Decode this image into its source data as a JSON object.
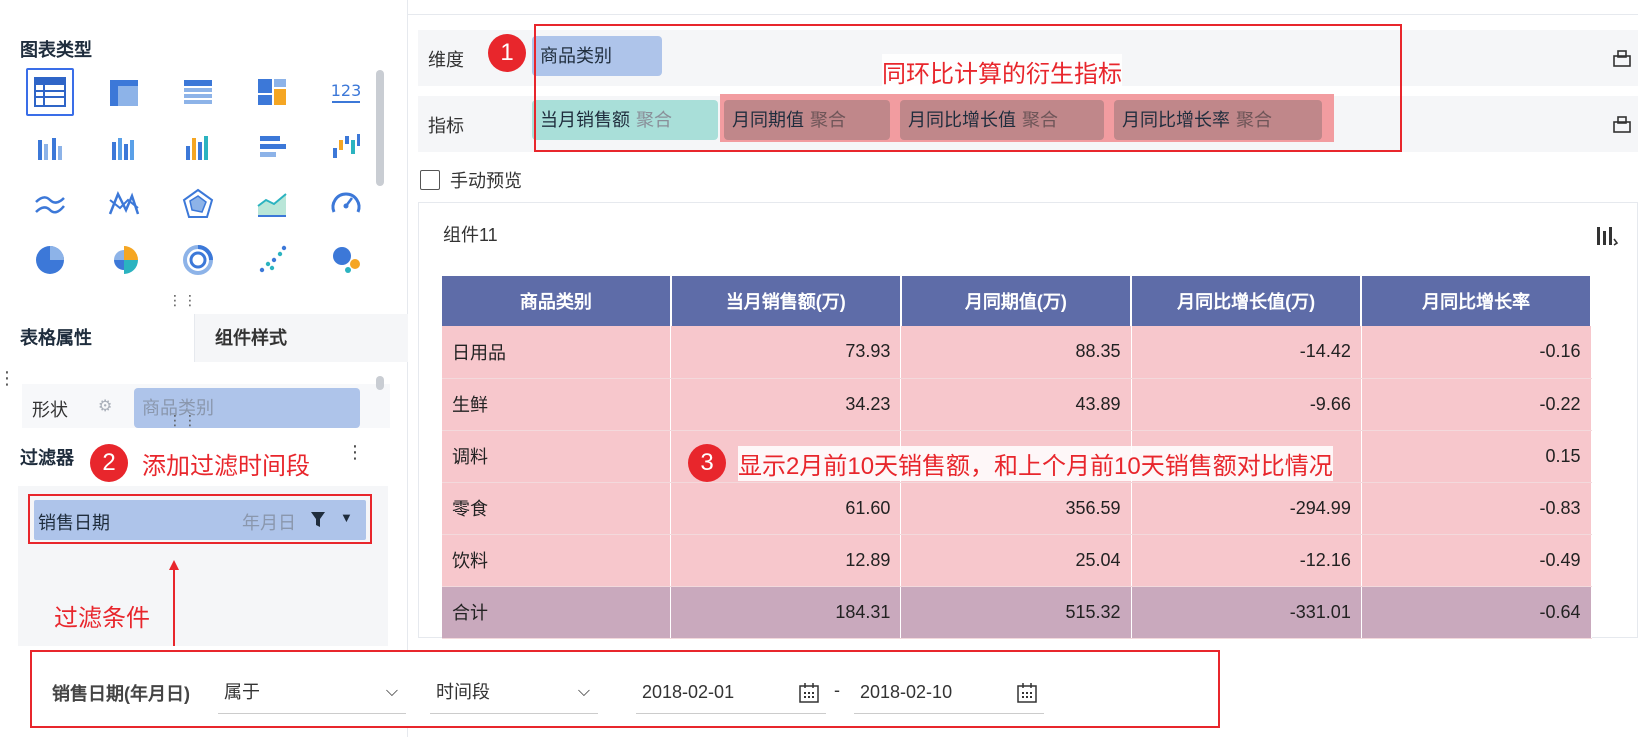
{
  "left": {
    "chart_type_title": "图表类型",
    "chart_icons": [
      "table-icon",
      "grouped-table-icon",
      "detail-table-icon",
      "treemap-icon",
      "number-card-icon",
      "grouped-bar-icon",
      "stacked-bar-icon",
      "multi-bar-icon",
      "horizontal-bar-icon",
      "waterfall-icon",
      "line-icon",
      "radar-line-icon",
      "radar-icon",
      "area-icon",
      "gauge-icon",
      "pie-icon",
      "rose-pie-icon",
      "ring-icon",
      "scatter-icon",
      "bubble-icon"
    ],
    "tabs": [
      "表格属性",
      "组件样式"
    ],
    "shape_label": "形状",
    "shape_value": "商品类别",
    "filter_title": "过滤器",
    "filter_field": "销售日期",
    "filter_granularity": "年月日"
  },
  "annotations": {
    "n1": "1",
    "n2": "2",
    "n3": "3",
    "text1": "同环比计算的衍生指标",
    "text2": "添加过滤时间段",
    "text3": "显示2月前10天销售额，和上个月前10天销售额对比情况",
    "filter_note": "过滤条件",
    "color": "#e8262c"
  },
  "config": {
    "dimension_label": "维度",
    "dimension_field": "商品类别",
    "metric_label": "指标",
    "metrics": [
      {
        "name": "当月销售额",
        "agg": "聚合"
      },
      {
        "name": "月同期值",
        "agg": "聚合"
      },
      {
        "name": "月同比增长值",
        "agg": "聚合"
      },
      {
        "name": "月同比增长率",
        "agg": "聚合"
      }
    ],
    "manual_preview": "手动预览"
  },
  "widget": {
    "title": "组件11",
    "table": {
      "headers": [
        "商品类别",
        "当月销售额(万)",
        "月同期值(万)",
        "月同比增长值(万)",
        "月同比增长率"
      ],
      "rows": [
        [
          "日用品",
          "73.93",
          "88.35",
          "-14.42",
          "-0.16"
        ],
        [
          "生鲜",
          "34.23",
          "43.89",
          "-9.66",
          "-0.22"
        ],
        [
          "调料",
          "",
          "",
          "",
          "0.15"
        ],
        [
          "零食",
          "61.60",
          "356.59",
          "-294.99",
          "-0.83"
        ],
        [
          "饮料",
          "12.89",
          "25.04",
          "-12.16",
          "-0.49"
        ]
      ],
      "total": [
        "合计",
        "184.31",
        "515.32",
        "-331.01",
        "-0.64"
      ]
    }
  },
  "filter_condition": {
    "field_label": "销售日期(年月日)",
    "operator": "属于",
    "type": "时间段",
    "start_date": "2018-02-01",
    "separator": "-",
    "end_date": "2018-02-10"
  }
}
